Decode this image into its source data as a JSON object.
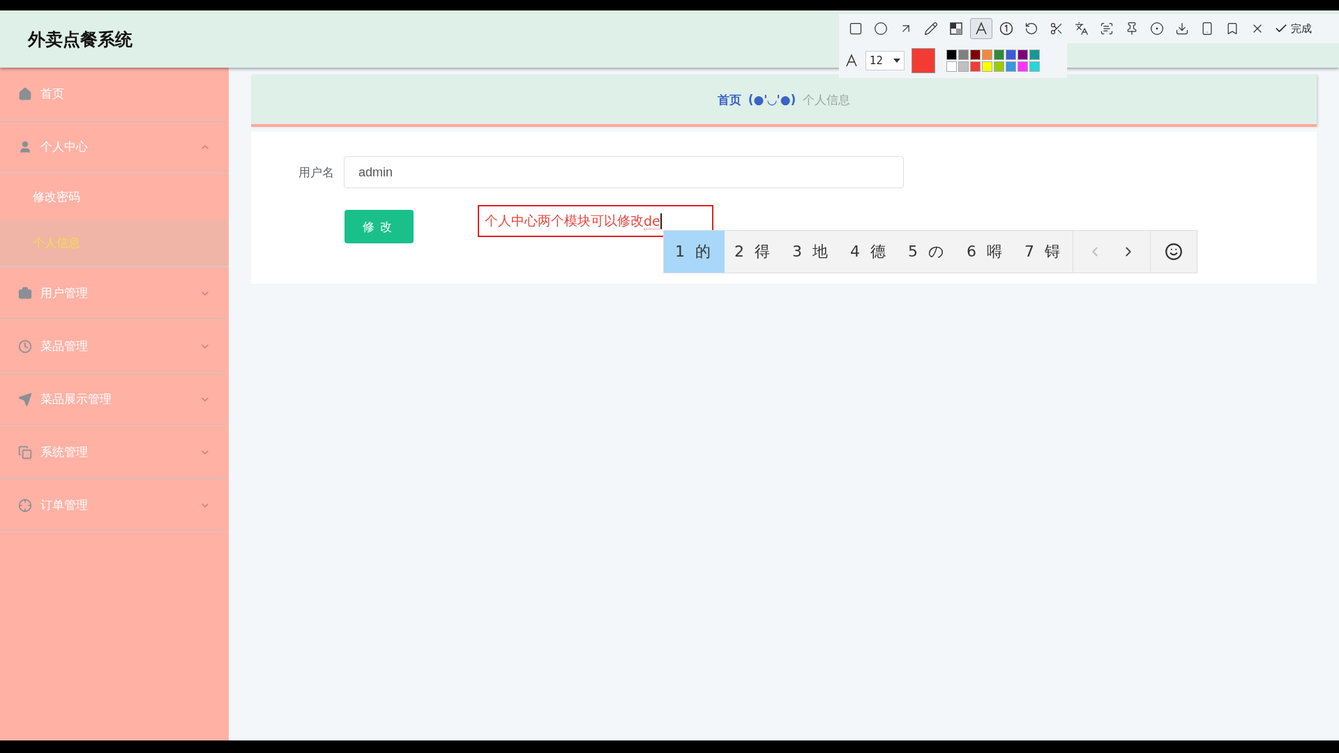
{
  "app_title": "外卖点餐系统",
  "sidebar": {
    "items": [
      {
        "label": "首页",
        "kind": "link"
      },
      {
        "label": "个人中心",
        "kind": "group",
        "expanded": true,
        "children": [
          {
            "label": "修改密码",
            "selected": false
          },
          {
            "label": "个人信息",
            "selected": true
          }
        ]
      },
      {
        "label": "用户管理",
        "kind": "group",
        "expanded": false
      },
      {
        "label": "菜品管理",
        "kind": "group",
        "expanded": false
      },
      {
        "label": "菜品展示管理",
        "kind": "group",
        "expanded": false
      },
      {
        "label": "系统管理",
        "kind": "group",
        "expanded": false
      },
      {
        "label": "订单管理",
        "kind": "group",
        "expanded": false
      }
    ]
  },
  "breadcrumb": {
    "items": [
      "首页",
      "个人信息"
    ],
    "separator": "(●'◡'●)"
  },
  "form": {
    "fields": [
      {
        "label": "用户名",
        "value": "admin"
      }
    ],
    "submit": "修改"
  },
  "annotation": {
    "text": "个人中心两个模块可以修改",
    "composing": "de"
  },
  "ime": {
    "candidates": [
      {
        "label": "1 的",
        "selected": true
      },
      {
        "label": "2 得",
        "selected": false
      },
      {
        "label": "3 地",
        "selected": false
      },
      {
        "label": "4 德",
        "selected": false
      },
      {
        "label": "5 の",
        "selected": false
      },
      {
        "label": "6 嘚",
        "selected": false
      },
      {
        "label": "7 锝",
        "selected": false
      }
    ]
  },
  "capture_toolbar": {
    "tools": [
      {
        "kind": "rect",
        "selected": false
      },
      {
        "kind": "ellipse",
        "selected": false
      },
      {
        "kind": "arrow",
        "selected": false
      },
      {
        "kind": "pencil",
        "selected": false
      },
      {
        "kind": "mosaic",
        "selected": false
      },
      {
        "kind": "text",
        "selected": true
      },
      {
        "kind": "number",
        "selected": false
      },
      {
        "kind": "undo",
        "selected": false
      },
      {
        "kind": "cut",
        "selected": false
      },
      {
        "kind": "translate",
        "selected": false
      },
      {
        "kind": "ocr",
        "selected": false
      },
      {
        "kind": "pin",
        "selected": false
      },
      {
        "kind": "record",
        "selected": false
      },
      {
        "kind": "download",
        "selected": false
      },
      {
        "kind": "phone",
        "selected": false
      },
      {
        "kind": "bookmark",
        "selected": false
      },
      {
        "kind": "close",
        "selected": false
      }
    ],
    "done": "完成",
    "font_size": "12",
    "current": {
      "color": "#f23c33"
    },
    "palette": [
      {
        "color": "#000000"
      },
      {
        "color": "#808080"
      },
      {
        "color": "#800000"
      },
      {
        "color": "#f08a3c"
      },
      {
        "color": "#2e8b3a"
      },
      {
        "color": "#3a5bd9"
      },
      {
        "color": "#800080"
      },
      {
        "color": "#109a96"
      },
      {
        "color": "#ffffff"
      },
      {
        "color": "#c0c0c0"
      },
      {
        "color": "#f23c33"
      },
      {
        "color": "#ffff00"
      },
      {
        "color": "#99cc00"
      },
      {
        "color": "#3a96e6"
      },
      {
        "color": "#ff33ff"
      },
      {
        "color": "#22d8d8"
      }
    ]
  }
}
